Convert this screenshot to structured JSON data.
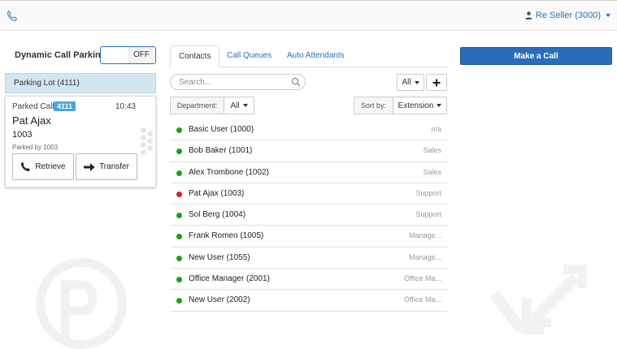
{
  "header": {
    "phone_icon": "phone-icon",
    "user_label": "Re Seller (3000)"
  },
  "parking": {
    "dynamic_label": "Dynamic Call Parking",
    "toggle_state": "OFF",
    "lot_label": "Parking Lot (4111)",
    "card": {
      "label": "Parked Call",
      "badge": "4111",
      "time": "10:43",
      "name": "Pat Ajax",
      "ext": "1003",
      "parked_by": "Parked by 1003",
      "retrieve_label": "Retrieve",
      "transfer_label": "Transfer"
    }
  },
  "tabs": [
    {
      "label": "Contacts",
      "active": true
    },
    {
      "label": "Call Queues",
      "active": false
    },
    {
      "label": "Auto Attendants",
      "active": false
    }
  ],
  "search": {
    "placeholder": "Search..."
  },
  "filters": {
    "all_label": "All",
    "department_label": "Department:",
    "department_value": "All",
    "sort_label": "Sort by:",
    "sort_value": "Extension"
  },
  "contacts": [
    {
      "name": "Basic User (1000)",
      "dept": "n/a",
      "status_color": "#1e9e1e"
    },
    {
      "name": "Bob Baker (1001)",
      "dept": "Sales",
      "status_color": "#1e9e1e"
    },
    {
      "name": "Alex Trombone (1002)",
      "dept": "Sales",
      "status_color": "#1e9e1e"
    },
    {
      "name": "Pat Ajax (1003)",
      "dept": "Support",
      "status_color": "#d9231c"
    },
    {
      "name": "Sol Berg (1004)",
      "dept": "Support",
      "status_color": "#1e9e1e"
    },
    {
      "name": "Frank Romeo (1005)",
      "dept": "Manage...",
      "status_color": "#1e9e1e"
    },
    {
      "name": "New User (1055)",
      "dept": "Manage...",
      "status_color": "#1e9e1e"
    },
    {
      "name": "Office Manager (2001)",
      "dept": "Office Ma...",
      "status_color": "#1e9e1e"
    },
    {
      "name": "New User (2002)",
      "dept": "Office Ma...",
      "status_color": "#1e9e1e"
    }
  ],
  "actions": {
    "make_call_label": "Make a Call"
  },
  "colors": {
    "accent": "#2a6ebb",
    "online": "#1e9e1e",
    "busy": "#d9231c",
    "badge": "#4aa3df"
  }
}
